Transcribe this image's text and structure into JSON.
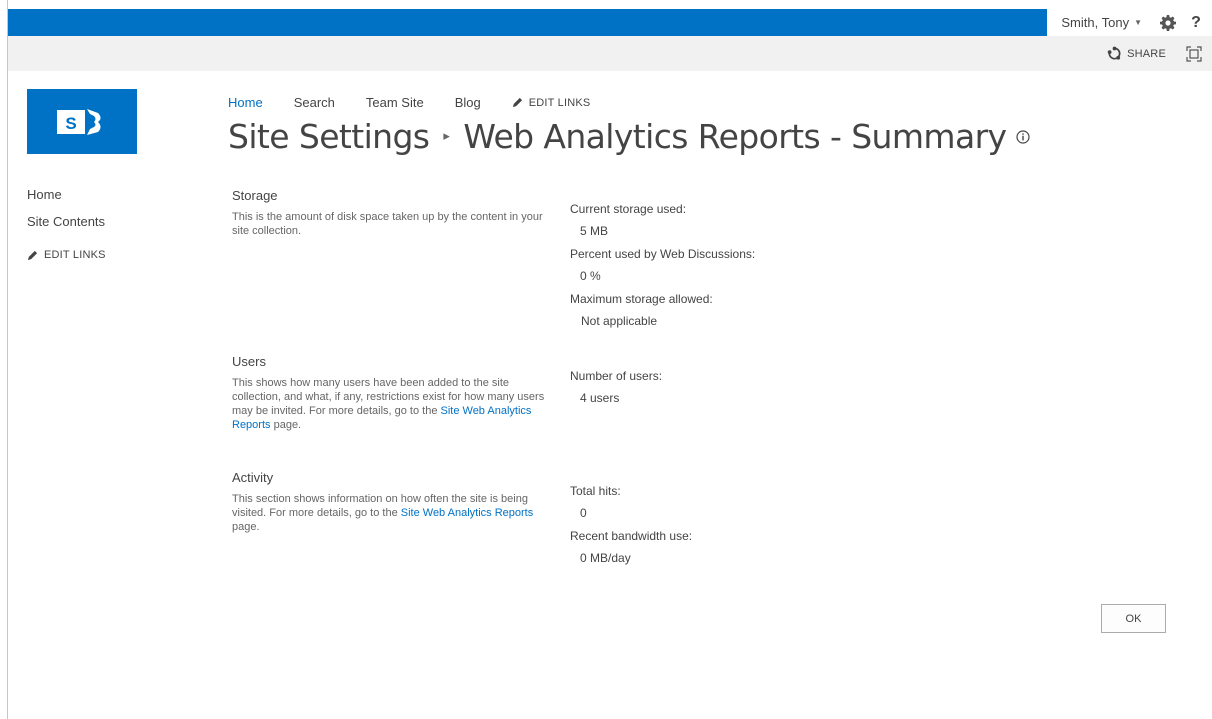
{
  "suite_bar": {
    "user_name": "Smith, Tony",
    "settings_icon": "gear-icon",
    "help_label": "?",
    "brand_color": "#0072c6"
  },
  "ribbon": {
    "share_label": "SHARE"
  },
  "top_nav": {
    "items": [
      "Home",
      "Search",
      "Team Site",
      "Blog"
    ],
    "edit_links": "EDIT LINKS"
  },
  "page_title": {
    "parent": "Site Settings",
    "current": "Web Analytics Reports - Summary"
  },
  "left_nav": {
    "items": [
      "Home",
      "Site Contents"
    ],
    "edit_links": "EDIT LINKS"
  },
  "sections": {
    "storage": {
      "heading": "Storage",
      "description": "This is the amount of disk space taken up by the content in your site collection.",
      "stats": [
        {
          "label": "Current storage used:",
          "value": "5 MB"
        },
        {
          "label": "Percent used by Web Discussions:",
          "value": "0 %"
        },
        {
          "label": "Maximum storage allowed:",
          "value": "Not applicable"
        }
      ]
    },
    "users": {
      "heading": "Users",
      "description_before": "This shows how many users have been added to the site collection, and what, if any, restrictions exist for how many users may be invited. For more details, go to the ",
      "link": "Site Web Analytics Reports",
      "description_after": " page.",
      "stats": [
        {
          "label": "Number of users:",
          "value": "4 users"
        }
      ]
    },
    "activity": {
      "heading": "Activity",
      "description_before": "This section shows information on how often the site is being visited. For more details, go to the ",
      "link": "Site Web Analytics Reports",
      "description_after": " page.",
      "stats": [
        {
          "label": "Total hits:",
          "value": "0"
        },
        {
          "label": "Recent bandwidth use:",
          "value": "0 MB/day"
        }
      ]
    }
  },
  "ok_label": "OK"
}
